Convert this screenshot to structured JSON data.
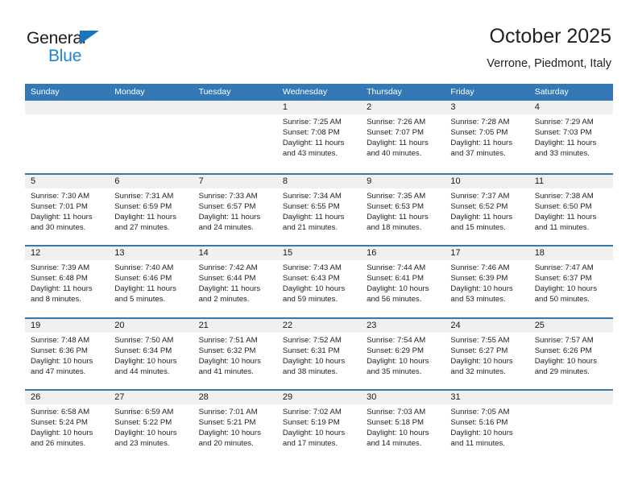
{
  "brand": {
    "line1": "General",
    "line2": "Blue",
    "triangle_color": "#1b75bb",
    "blue_color": "#1b86d6"
  },
  "header": {
    "title": "October 2025",
    "subtitle": "Verrone, Piedmont, Italy"
  },
  "colors": {
    "header_blue": "#3479b5",
    "day_band": "#f0f0f0",
    "text": "#232323"
  },
  "weekdays": [
    "Sunday",
    "Monday",
    "Tuesday",
    "Wednesday",
    "Thursday",
    "Friday",
    "Saturday"
  ],
  "labels": {
    "sunrise": "Sunrise:",
    "sunset": "Sunset:",
    "daylight": "Daylight:"
  },
  "weeks": [
    [
      {
        "day": "",
        "empty": true
      },
      {
        "day": "",
        "empty": true
      },
      {
        "day": "",
        "empty": true
      },
      {
        "day": "1",
        "sunrise": "Sunrise: 7:25 AM",
        "sunset": "Sunset: 7:08 PM",
        "daylight1": "Daylight: 11 hours",
        "daylight2": "and 43 minutes."
      },
      {
        "day": "2",
        "sunrise": "Sunrise: 7:26 AM",
        "sunset": "Sunset: 7:07 PM",
        "daylight1": "Daylight: 11 hours",
        "daylight2": "and 40 minutes."
      },
      {
        "day": "3",
        "sunrise": "Sunrise: 7:28 AM",
        "sunset": "Sunset: 7:05 PM",
        "daylight1": "Daylight: 11 hours",
        "daylight2": "and 37 minutes."
      },
      {
        "day": "4",
        "sunrise": "Sunrise: 7:29 AM",
        "sunset": "Sunset: 7:03 PM",
        "daylight1": "Daylight: 11 hours",
        "daylight2": "and 33 minutes."
      }
    ],
    [
      {
        "day": "5",
        "sunrise": "Sunrise: 7:30 AM",
        "sunset": "Sunset: 7:01 PM",
        "daylight1": "Daylight: 11 hours",
        "daylight2": "and 30 minutes."
      },
      {
        "day": "6",
        "sunrise": "Sunrise: 7:31 AM",
        "sunset": "Sunset: 6:59 PM",
        "daylight1": "Daylight: 11 hours",
        "daylight2": "and 27 minutes."
      },
      {
        "day": "7",
        "sunrise": "Sunrise: 7:33 AM",
        "sunset": "Sunset: 6:57 PM",
        "daylight1": "Daylight: 11 hours",
        "daylight2": "and 24 minutes."
      },
      {
        "day": "8",
        "sunrise": "Sunrise: 7:34 AM",
        "sunset": "Sunset: 6:55 PM",
        "daylight1": "Daylight: 11 hours",
        "daylight2": "and 21 minutes."
      },
      {
        "day": "9",
        "sunrise": "Sunrise: 7:35 AM",
        "sunset": "Sunset: 6:53 PM",
        "daylight1": "Daylight: 11 hours",
        "daylight2": "and 18 minutes."
      },
      {
        "day": "10",
        "sunrise": "Sunrise: 7:37 AM",
        "sunset": "Sunset: 6:52 PM",
        "daylight1": "Daylight: 11 hours",
        "daylight2": "and 15 minutes."
      },
      {
        "day": "11",
        "sunrise": "Sunrise: 7:38 AM",
        "sunset": "Sunset: 6:50 PM",
        "daylight1": "Daylight: 11 hours",
        "daylight2": "and 11 minutes."
      }
    ],
    [
      {
        "day": "12",
        "sunrise": "Sunrise: 7:39 AM",
        "sunset": "Sunset: 6:48 PM",
        "daylight1": "Daylight: 11 hours",
        "daylight2": "and 8 minutes."
      },
      {
        "day": "13",
        "sunrise": "Sunrise: 7:40 AM",
        "sunset": "Sunset: 6:46 PM",
        "daylight1": "Daylight: 11 hours",
        "daylight2": "and 5 minutes."
      },
      {
        "day": "14",
        "sunrise": "Sunrise: 7:42 AM",
        "sunset": "Sunset: 6:44 PM",
        "daylight1": "Daylight: 11 hours",
        "daylight2": "and 2 minutes."
      },
      {
        "day": "15",
        "sunrise": "Sunrise: 7:43 AM",
        "sunset": "Sunset: 6:43 PM",
        "daylight1": "Daylight: 10 hours",
        "daylight2": "and 59 minutes."
      },
      {
        "day": "16",
        "sunrise": "Sunrise: 7:44 AM",
        "sunset": "Sunset: 6:41 PM",
        "daylight1": "Daylight: 10 hours",
        "daylight2": "and 56 minutes."
      },
      {
        "day": "17",
        "sunrise": "Sunrise: 7:46 AM",
        "sunset": "Sunset: 6:39 PM",
        "daylight1": "Daylight: 10 hours",
        "daylight2": "and 53 minutes."
      },
      {
        "day": "18",
        "sunrise": "Sunrise: 7:47 AM",
        "sunset": "Sunset: 6:37 PM",
        "daylight1": "Daylight: 10 hours",
        "daylight2": "and 50 minutes."
      }
    ],
    [
      {
        "day": "19",
        "sunrise": "Sunrise: 7:48 AM",
        "sunset": "Sunset: 6:36 PM",
        "daylight1": "Daylight: 10 hours",
        "daylight2": "and 47 minutes."
      },
      {
        "day": "20",
        "sunrise": "Sunrise: 7:50 AM",
        "sunset": "Sunset: 6:34 PM",
        "daylight1": "Daylight: 10 hours",
        "daylight2": "and 44 minutes."
      },
      {
        "day": "21",
        "sunrise": "Sunrise: 7:51 AM",
        "sunset": "Sunset: 6:32 PM",
        "daylight1": "Daylight: 10 hours",
        "daylight2": "and 41 minutes."
      },
      {
        "day": "22",
        "sunrise": "Sunrise: 7:52 AM",
        "sunset": "Sunset: 6:31 PM",
        "daylight1": "Daylight: 10 hours",
        "daylight2": "and 38 minutes."
      },
      {
        "day": "23",
        "sunrise": "Sunrise: 7:54 AM",
        "sunset": "Sunset: 6:29 PM",
        "daylight1": "Daylight: 10 hours",
        "daylight2": "and 35 minutes."
      },
      {
        "day": "24",
        "sunrise": "Sunrise: 7:55 AM",
        "sunset": "Sunset: 6:27 PM",
        "daylight1": "Daylight: 10 hours",
        "daylight2": "and 32 minutes."
      },
      {
        "day": "25",
        "sunrise": "Sunrise: 7:57 AM",
        "sunset": "Sunset: 6:26 PM",
        "daylight1": "Daylight: 10 hours",
        "daylight2": "and 29 minutes."
      }
    ],
    [
      {
        "day": "26",
        "sunrise": "Sunrise: 6:58 AM",
        "sunset": "Sunset: 5:24 PM",
        "daylight1": "Daylight: 10 hours",
        "daylight2": "and 26 minutes."
      },
      {
        "day": "27",
        "sunrise": "Sunrise: 6:59 AM",
        "sunset": "Sunset: 5:22 PM",
        "daylight1": "Daylight: 10 hours",
        "daylight2": "and 23 minutes."
      },
      {
        "day": "28",
        "sunrise": "Sunrise: 7:01 AM",
        "sunset": "Sunset: 5:21 PM",
        "daylight1": "Daylight: 10 hours",
        "daylight2": "and 20 minutes."
      },
      {
        "day": "29",
        "sunrise": "Sunrise: 7:02 AM",
        "sunset": "Sunset: 5:19 PM",
        "daylight1": "Daylight: 10 hours",
        "daylight2": "and 17 minutes."
      },
      {
        "day": "30",
        "sunrise": "Sunrise: 7:03 AM",
        "sunset": "Sunset: 5:18 PM",
        "daylight1": "Daylight: 10 hours",
        "daylight2": "and 14 minutes."
      },
      {
        "day": "31",
        "sunrise": "Sunrise: 7:05 AM",
        "sunset": "Sunset: 5:16 PM",
        "daylight1": "Daylight: 10 hours",
        "daylight2": "and 11 minutes."
      },
      {
        "day": "",
        "empty": true
      }
    ]
  ]
}
